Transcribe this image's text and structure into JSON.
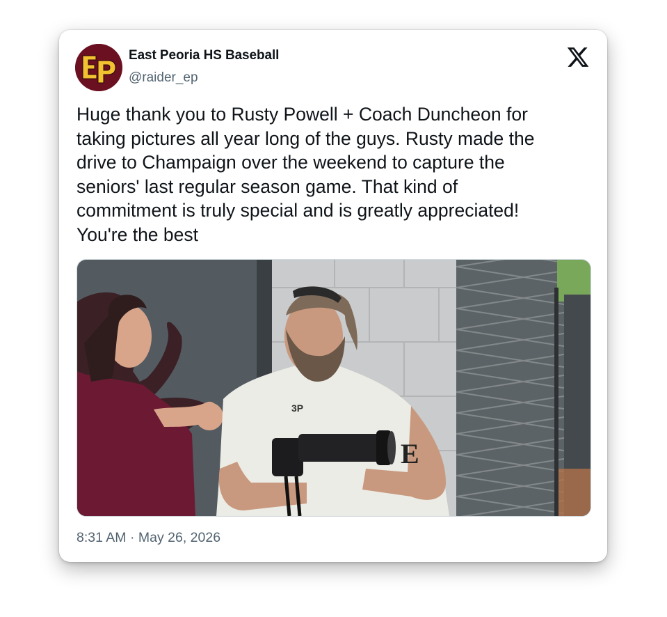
{
  "author": {
    "display_name": "East Peoria HS Baseball",
    "handle": "@raider_ep",
    "avatar_initials": "EP",
    "avatar_colors": {
      "background": "#6b1020",
      "letters": "#f2c230"
    }
  },
  "platform_icon": "x-logo-icon",
  "tweet": {
    "text": "Huge thank you to Rusty Powell + Coach Duncheon for\ntaking pictures all year long of the guys. Rusty made the\ndrive to Champaign over the weekend to capture the\nseniors' last regular season game. That kind of\ncommitment is truly special and is greatly appreciated!\nYou're the best",
    "timestamp": "8:31 AM · May 26, 2026"
  },
  "colors": {
    "primary_text": "#0f1419",
    "secondary_text": "#536471",
    "card_background": "#ffffff"
  }
}
